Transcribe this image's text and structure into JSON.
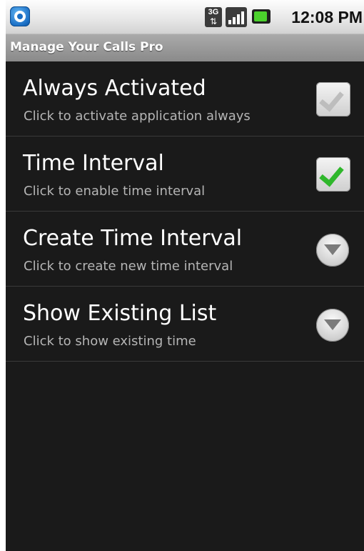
{
  "status_bar": {
    "app_icon": "blue-phone-app-icon",
    "network_label": "3G",
    "signal_icon": "signal-bars-icon",
    "battery_icon": "battery-charging-icon",
    "time": "12:08 PM"
  },
  "app": {
    "title": "Manage Your Calls Pro"
  },
  "settings": [
    {
      "title": "Always Activated",
      "subtitle": "Click to activate application always",
      "control": "checkbox",
      "checked": false
    },
    {
      "title": "Time Interval",
      "subtitle": "Click to enable time interval",
      "control": "checkbox",
      "checked": true
    },
    {
      "title": "Create Time Interval",
      "subtitle": "Click to create new time interval",
      "control": "expand-arrow"
    },
    {
      "title": "Show Existing List",
      "subtitle": "Click to show existing time",
      "control": "expand-arrow"
    }
  ],
  "colors": {
    "background": "#1a1a1a",
    "title_bar": "#9a9a9a",
    "check_active": "#2fb72b",
    "check_inactive": "#bdbdbd",
    "subtitle_text": "#b5b5b5"
  }
}
